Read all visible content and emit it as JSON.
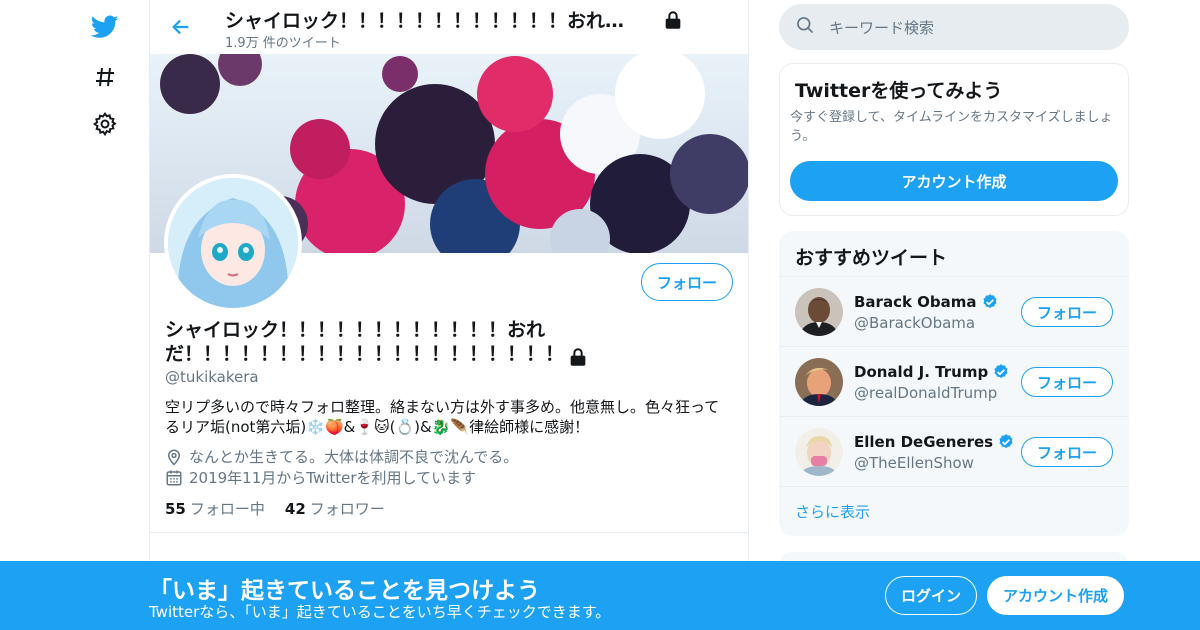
{
  "colors": {
    "brand": "#1da1f2",
    "text": "#14171a",
    "secondary": "#657786",
    "border": "#e6ecf0",
    "verified": "#1da1f2"
  },
  "left_nav": {
    "icons": [
      "twitter-bird-icon",
      "hashtag-icon",
      "gear-icon"
    ]
  },
  "header": {
    "name": "シャイロック！！！！！！！！！！！！おれ…",
    "tweet_count": "1.9万 件のツイート"
  },
  "profile": {
    "name": "シャイロック！！！！！！！！！！！！おれだ！！！！！！！！！！！！！！！！！！！！",
    "handle": "@tukikakera",
    "follow_label": "フォロー",
    "bio": "空リプ多いので時々フォロ整理。絡まない方は外す事多め。他意無し。色々狂ってるリア垢(not第六垢)❄️🍑&🍷🐱(💍)&🐉🪶律絵師様に感謝！",
    "location": "なんとか生きてる。大体は体調不良で沈んでる。",
    "joined": "2019年11月からTwitterを利用しています",
    "following_count": "55",
    "following_label": "フォロー中",
    "followers_count": "42",
    "followers_label": "フォロワー"
  },
  "search": {
    "placeholder": "キーワード検索"
  },
  "signup_card": {
    "title": "Twitterを使ってみよう",
    "description": "今すぐ登録して、タイムラインをカスタマイズしましょう。",
    "button": "アカウント作成"
  },
  "recommend": {
    "title": "おすすめツイート",
    "users": [
      {
        "name": "Barack Obama",
        "handle": "@BarackObama",
        "follow": "フォロー"
      },
      {
        "name": "Donald J. Trump",
        "handle": "@realDonaldTrump",
        "follow": "フォロー"
      },
      {
        "name": "Ellen DeGeneres",
        "handle": "@TheEllenShow",
        "follow": "フォロー"
      }
    ],
    "show_more": "さらに表示"
  },
  "bottom_bar": {
    "title": "「いま」起きていることを見つけよう",
    "subtitle": "Twitterなら、「いま」起きていることをいち早くチェックできます。",
    "login": "ログイン",
    "signup": "アカウント作成"
  }
}
